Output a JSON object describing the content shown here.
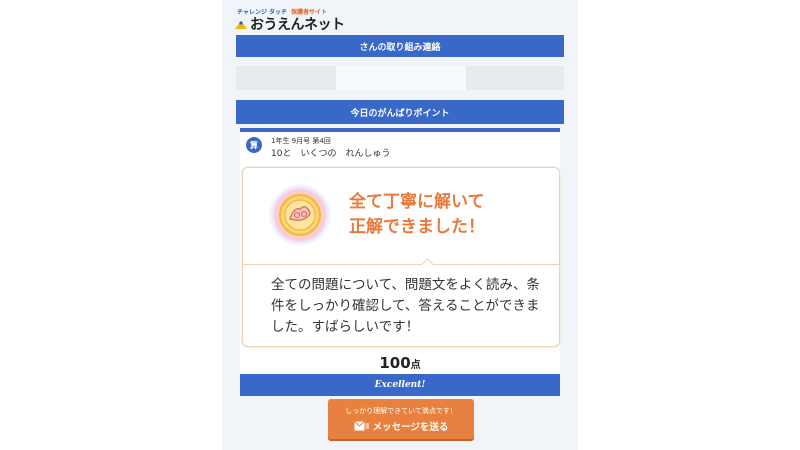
{
  "header": {
    "brand_small": "チャレンジ タッチ",
    "brand_sub": "保護者サイト",
    "logo_text": "おうえんネット"
  },
  "contact_bar": {
    "title": "さんの取り組み連絡"
  },
  "points_bar": {
    "title": "今日のがんばりポイント"
  },
  "lesson": {
    "subject_icon": "算",
    "info": "1年生 9月号 第4回",
    "title": "10と　いくつの　れんしゅう"
  },
  "award": {
    "headline_line1": "全て丁寧に解いて",
    "headline_line2": "正解できました！",
    "description": "全ての問題について、問題文をよく読み、条件をしっかり確認して、答えることができました。すばらしいです！"
  },
  "score": {
    "value": "100",
    "unit": "点"
  },
  "excellent_label": "Excellent!",
  "send_button": {
    "sub_label": "しっかり理解できていて満点です！",
    "main_label": "メッセージを送る"
  },
  "colors": {
    "primary_blue": "#3a68c8",
    "accent_orange": "#e8813f",
    "headline_orange": "#e87b3a"
  },
  "icons": [
    "logo-mark-icon",
    "medal-icon",
    "mail-icon"
  ]
}
